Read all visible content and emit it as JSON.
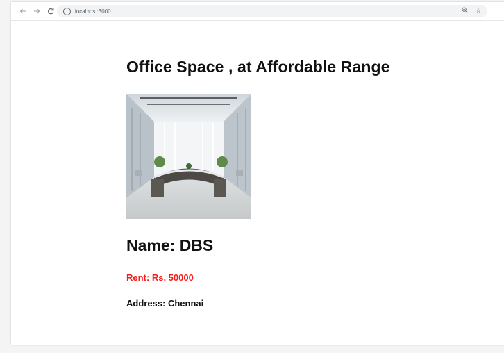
{
  "browser": {
    "url": "localhost:3000",
    "info_icon": "info-icon",
    "zoom_icon": "zoom-icon",
    "star_icon": "star-icon"
  },
  "page": {
    "heading": "Office Space , at Affordable Range",
    "image_alt": "office-lobby-photo",
    "name": "Name: DBS",
    "rent": "Rent: Rs. 50000",
    "address": "Address: Chennai"
  },
  "colors": {
    "rent": "#ff1a1a",
    "text": "#111111",
    "page_background": "#ffffff"
  }
}
